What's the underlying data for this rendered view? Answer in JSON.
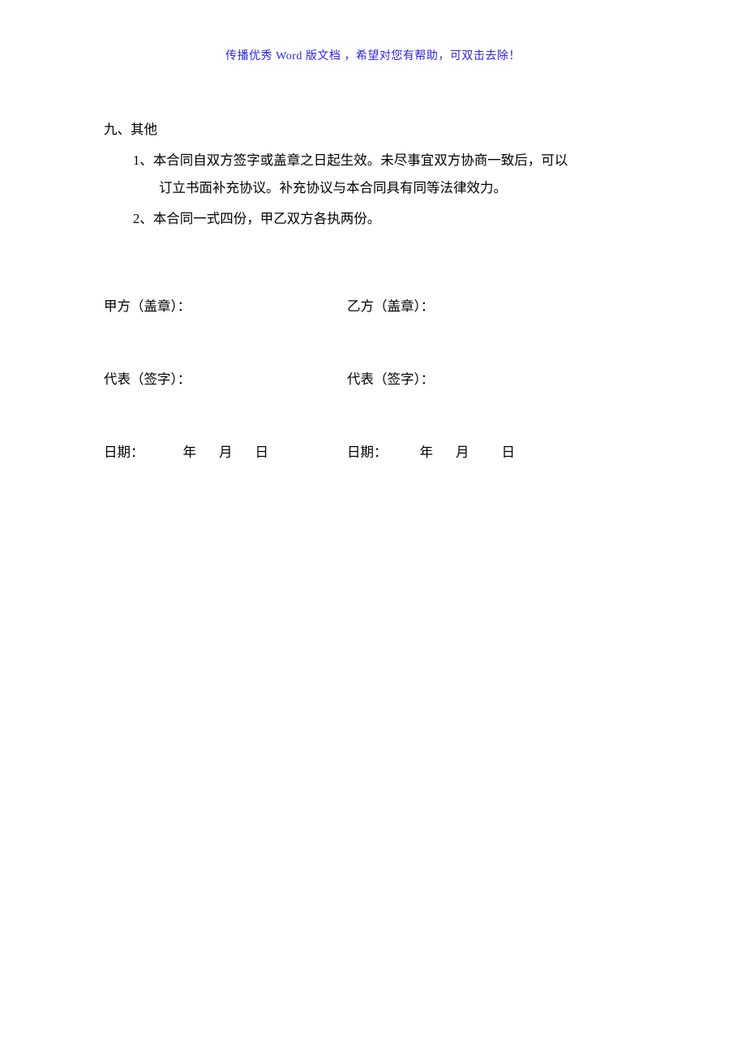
{
  "header_note": "传播优秀 Word 版文档 ，希望对您有帮助，可双击去除！",
  "section": {
    "heading": "九、其他",
    "items": [
      {
        "number": "1、",
        "line1": "本合同自双方签字或盖章之日起生效。未尽事宜双方协商一致后，可以",
        "line2": "订立书面补充协议。补充协议与本合同具有同等法律效力。"
      },
      {
        "number": "2、",
        "line1": "本合同一式四份，甲乙双方各执两份。",
        "line2": ""
      }
    ]
  },
  "signatures": {
    "party_a_seal": "甲方（盖章）：",
    "party_b_seal": "乙方（盖章）：",
    "rep_a_sign": "代表（签字）：",
    "rep_b_sign": "代表（签字）：",
    "date_label": "日期：",
    "year": "年",
    "month": "月",
    "day": "日"
  }
}
